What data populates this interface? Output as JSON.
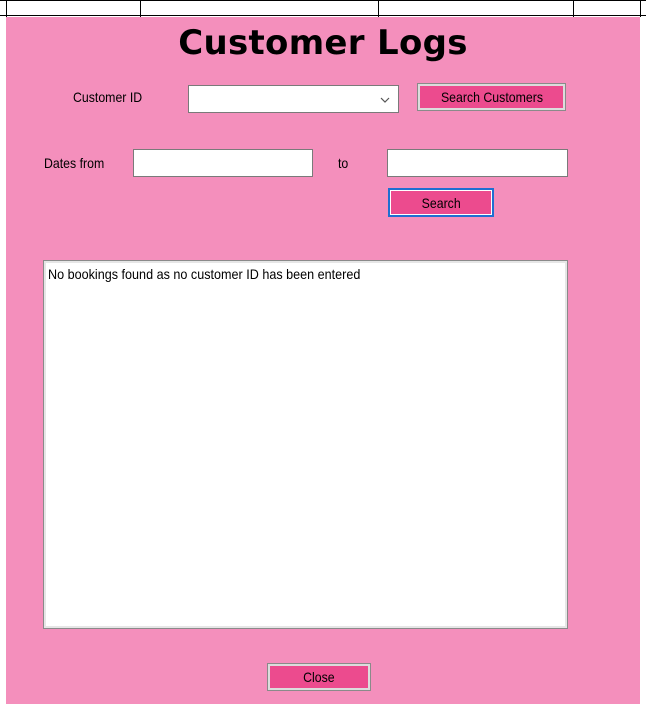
{
  "window": {
    "title": "Customer Logs"
  },
  "customer_search": {
    "label": "Customer ID",
    "combo_value": "",
    "button_label": "Search Customers"
  },
  "date_search": {
    "from_label": "Dates from",
    "to_label": "to",
    "from_value": "",
    "to_value": "",
    "button_label": "Search"
  },
  "results": {
    "items": [
      "No bookings found as no customer ID has been entered"
    ]
  },
  "footer": {
    "close_label": "Close"
  },
  "colors": {
    "background": "#f48fbc",
    "button": "#ec4b8e",
    "focus_border": "#1f6fd1"
  },
  "icons": {
    "dropdown": "chevron-down-icon"
  }
}
